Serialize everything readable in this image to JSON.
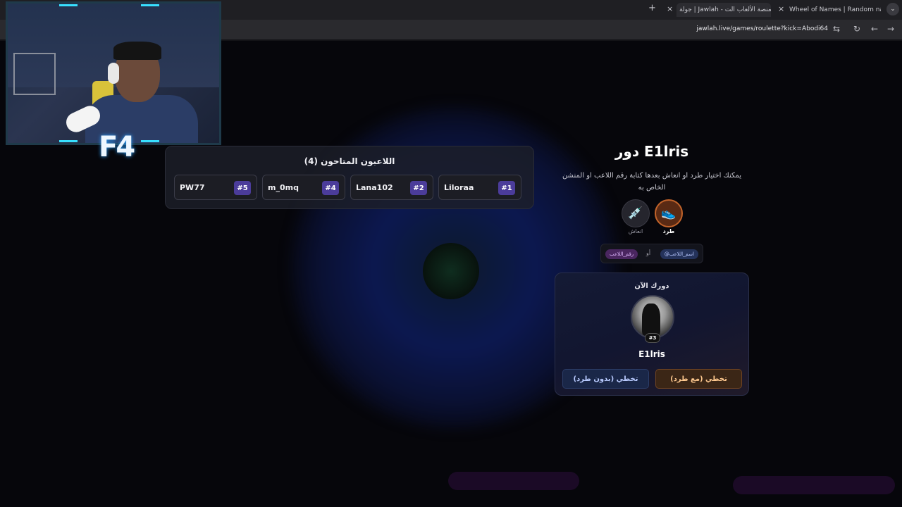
{
  "browser": {
    "tabs": [
      {
        "label": "Wheel of Names | Random nam",
        "active": false
      },
      {
        "label": "جولة | Jawlah - منصة الألعاب الت",
        "active": true
      }
    ],
    "new_tab_icon": "+",
    "close_icon": "×",
    "url": "jawlah.live/games/roulette?kick=Abodi64"
  },
  "webcam": {
    "logo_text": "F4"
  },
  "players": {
    "title": "اللاعبون المتاحون (4)",
    "list": [
      {
        "name": "Liloraa",
        "number": "#1"
      },
      {
        "name": "Lana102",
        "number": "#2"
      },
      {
        "name": "m_0mq",
        "number": "#4"
      },
      {
        "name": "PW77",
        "number": "#5"
      }
    ]
  },
  "turn": {
    "title": "دور E1lris",
    "description_line1": "يمكنك اختيار طرد او انعاش بعدها كتابة رقم اللاعب او المنشن",
    "description_line2": "الخاص به",
    "actions": {
      "kick": {
        "label": "طرد",
        "icon": "sneaker-icon"
      },
      "revive": {
        "label": "انعاش",
        "icon": "syringe-icon"
      }
    },
    "hint": {
      "name_pill": "@اسم_اللاعب",
      "or": "أو",
      "number_pill": "رقم_اللاعب"
    }
  },
  "current": {
    "title": "دورك الآن",
    "player_name": "E1lris",
    "badge": "#3",
    "skip_with_kick": "تخطي (مع طرد)",
    "skip_without_kick": "تخطي (بدون طرد)"
  },
  "colors": {
    "accent_purple": "#4b3c9a",
    "kick_orange": "#c2632a",
    "background": "#06060b"
  }
}
